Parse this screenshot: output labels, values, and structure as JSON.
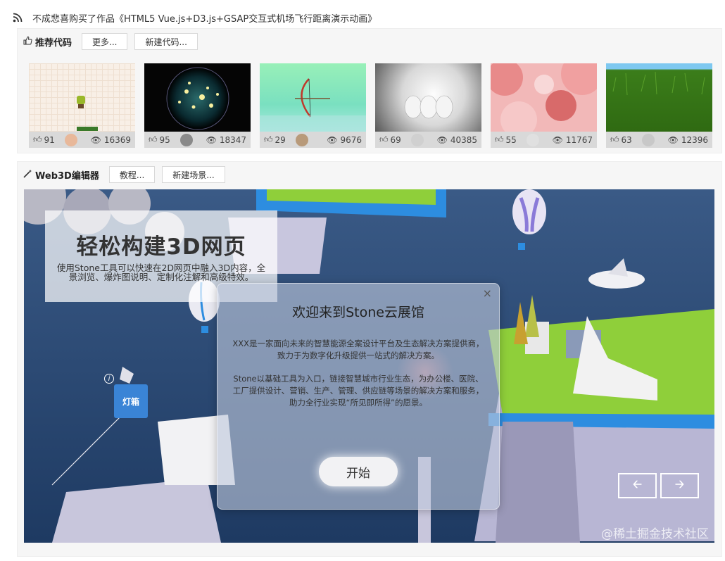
{
  "notice": {
    "icon": "rss-icon",
    "text": "不成悲喜购买了作品《HTML5 Vue.js+D3.js+GSAP交互式机场飞行距离演示动画》"
  },
  "recommend": {
    "title": "推荐代码",
    "icon": "thumbs-up-icon",
    "buttons": [
      "更多...",
      "新建代码..."
    ],
    "cards": [
      {
        "likes": "91",
        "views": "16369"
      },
      {
        "likes": "95",
        "views": "18347"
      },
      {
        "likes": "29",
        "views": "9676"
      },
      {
        "likes": "69",
        "views": "40385"
      },
      {
        "likes": "55",
        "views": "11767"
      },
      {
        "likes": "63",
        "views": "12396"
      }
    ]
  },
  "web3d": {
    "title": "Web3D编辑器",
    "icon": "magic-wand-icon",
    "buttons": [
      "教程...",
      "新建场景..."
    ],
    "hero": {
      "title": "轻松构建3D网页",
      "desc": "使用Stone工具可以快速在2D网页中融入3D内容，全景浏览、爆炸图说明、定制化注解和高级特效。"
    },
    "modal": {
      "title": "欢迎来到Stone云展馆",
      "p1": "XXX是一家面向未来的智慧能源全案设计平台及生态解决方案提供商，致力于为数字化升级提供一站式的解决方案。",
      "p2": "Stone以基础工具为入口，链接智慧城市行业生态，为办公楼、医院、工厂提供设计、营销、生产、管理、供应链等场景的解决方案和服务，助力全行业实现“所见即所得”的愿景。",
      "start": "开始",
      "close": "×"
    },
    "lamp_label": "灯箱",
    "nav": {
      "prev_icon": "arrow-left-icon",
      "next_icon": "arrow-right-icon"
    },
    "watermark": "@稀土掘金技术社区"
  }
}
